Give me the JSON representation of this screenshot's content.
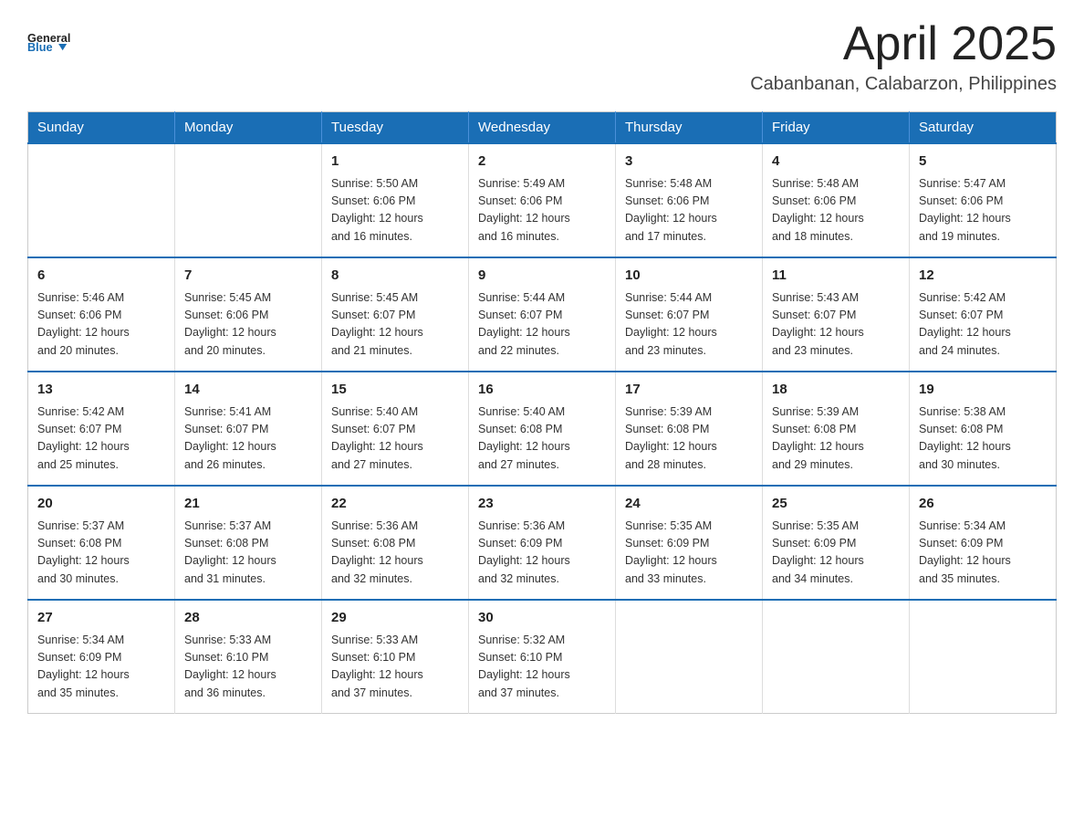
{
  "header": {
    "logo_general": "General",
    "logo_blue": "Blue",
    "month_title": "April 2025",
    "location": "Cabanbanan, Calabarzon, Philippines"
  },
  "weekdays": [
    "Sunday",
    "Monday",
    "Tuesday",
    "Wednesday",
    "Thursday",
    "Friday",
    "Saturday"
  ],
  "weeks": [
    [
      {
        "day": "",
        "info": ""
      },
      {
        "day": "",
        "info": ""
      },
      {
        "day": "1",
        "info": "Sunrise: 5:50 AM\nSunset: 6:06 PM\nDaylight: 12 hours\nand 16 minutes."
      },
      {
        "day": "2",
        "info": "Sunrise: 5:49 AM\nSunset: 6:06 PM\nDaylight: 12 hours\nand 16 minutes."
      },
      {
        "day": "3",
        "info": "Sunrise: 5:48 AM\nSunset: 6:06 PM\nDaylight: 12 hours\nand 17 minutes."
      },
      {
        "day": "4",
        "info": "Sunrise: 5:48 AM\nSunset: 6:06 PM\nDaylight: 12 hours\nand 18 minutes."
      },
      {
        "day": "5",
        "info": "Sunrise: 5:47 AM\nSunset: 6:06 PM\nDaylight: 12 hours\nand 19 minutes."
      }
    ],
    [
      {
        "day": "6",
        "info": "Sunrise: 5:46 AM\nSunset: 6:06 PM\nDaylight: 12 hours\nand 20 minutes."
      },
      {
        "day": "7",
        "info": "Sunrise: 5:45 AM\nSunset: 6:06 PM\nDaylight: 12 hours\nand 20 minutes."
      },
      {
        "day": "8",
        "info": "Sunrise: 5:45 AM\nSunset: 6:07 PM\nDaylight: 12 hours\nand 21 minutes."
      },
      {
        "day": "9",
        "info": "Sunrise: 5:44 AM\nSunset: 6:07 PM\nDaylight: 12 hours\nand 22 minutes."
      },
      {
        "day": "10",
        "info": "Sunrise: 5:44 AM\nSunset: 6:07 PM\nDaylight: 12 hours\nand 23 minutes."
      },
      {
        "day": "11",
        "info": "Sunrise: 5:43 AM\nSunset: 6:07 PM\nDaylight: 12 hours\nand 23 minutes."
      },
      {
        "day": "12",
        "info": "Sunrise: 5:42 AM\nSunset: 6:07 PM\nDaylight: 12 hours\nand 24 minutes."
      }
    ],
    [
      {
        "day": "13",
        "info": "Sunrise: 5:42 AM\nSunset: 6:07 PM\nDaylight: 12 hours\nand 25 minutes."
      },
      {
        "day": "14",
        "info": "Sunrise: 5:41 AM\nSunset: 6:07 PM\nDaylight: 12 hours\nand 26 minutes."
      },
      {
        "day": "15",
        "info": "Sunrise: 5:40 AM\nSunset: 6:07 PM\nDaylight: 12 hours\nand 27 minutes."
      },
      {
        "day": "16",
        "info": "Sunrise: 5:40 AM\nSunset: 6:08 PM\nDaylight: 12 hours\nand 27 minutes."
      },
      {
        "day": "17",
        "info": "Sunrise: 5:39 AM\nSunset: 6:08 PM\nDaylight: 12 hours\nand 28 minutes."
      },
      {
        "day": "18",
        "info": "Sunrise: 5:39 AM\nSunset: 6:08 PM\nDaylight: 12 hours\nand 29 minutes."
      },
      {
        "day": "19",
        "info": "Sunrise: 5:38 AM\nSunset: 6:08 PM\nDaylight: 12 hours\nand 30 minutes."
      }
    ],
    [
      {
        "day": "20",
        "info": "Sunrise: 5:37 AM\nSunset: 6:08 PM\nDaylight: 12 hours\nand 30 minutes."
      },
      {
        "day": "21",
        "info": "Sunrise: 5:37 AM\nSunset: 6:08 PM\nDaylight: 12 hours\nand 31 minutes."
      },
      {
        "day": "22",
        "info": "Sunrise: 5:36 AM\nSunset: 6:08 PM\nDaylight: 12 hours\nand 32 minutes."
      },
      {
        "day": "23",
        "info": "Sunrise: 5:36 AM\nSunset: 6:09 PM\nDaylight: 12 hours\nand 32 minutes."
      },
      {
        "day": "24",
        "info": "Sunrise: 5:35 AM\nSunset: 6:09 PM\nDaylight: 12 hours\nand 33 minutes."
      },
      {
        "day": "25",
        "info": "Sunrise: 5:35 AM\nSunset: 6:09 PM\nDaylight: 12 hours\nand 34 minutes."
      },
      {
        "day": "26",
        "info": "Sunrise: 5:34 AM\nSunset: 6:09 PM\nDaylight: 12 hours\nand 35 minutes."
      }
    ],
    [
      {
        "day": "27",
        "info": "Sunrise: 5:34 AM\nSunset: 6:09 PM\nDaylight: 12 hours\nand 35 minutes."
      },
      {
        "day": "28",
        "info": "Sunrise: 5:33 AM\nSunset: 6:10 PM\nDaylight: 12 hours\nand 36 minutes."
      },
      {
        "day": "29",
        "info": "Sunrise: 5:33 AM\nSunset: 6:10 PM\nDaylight: 12 hours\nand 37 minutes."
      },
      {
        "day": "30",
        "info": "Sunrise: 5:32 AM\nSunset: 6:10 PM\nDaylight: 12 hours\nand 37 minutes."
      },
      {
        "day": "",
        "info": ""
      },
      {
        "day": "",
        "info": ""
      },
      {
        "day": "",
        "info": ""
      }
    ]
  ]
}
